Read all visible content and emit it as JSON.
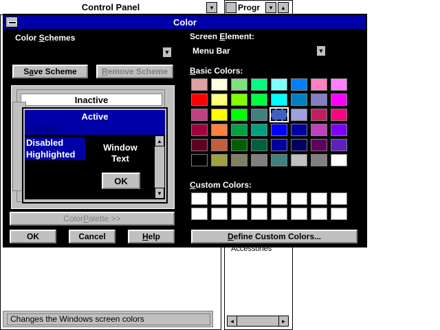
{
  "background": {
    "control_panel_title": "Control Panel",
    "program_manager_title": "Progr",
    "program_manager_item": "Accessories",
    "status_text": "Changes the Windows screen colors"
  },
  "dialog": {
    "title": "Color",
    "color_schemes_label_pre": "Color ",
    "color_schemes_label_u": "S",
    "color_schemes_label_post": "chemes",
    "color_scheme_value": "",
    "save_scheme_label_pre": "S",
    "save_scheme_label_u": "a",
    "save_scheme_label_post": "ve Scheme",
    "remove_scheme_label_pre": "",
    "remove_scheme_label_u": "R",
    "remove_scheme_label_post": "emove Scheme",
    "screen_element_label_pre": "Screen ",
    "screen_element_label_u": "E",
    "screen_element_label_post": "lement:",
    "screen_element_value": "Menu Bar",
    "basic_colors_label_u": "B",
    "basic_colors_label_post": "asic Colors:",
    "custom_colors_label_u": "C",
    "custom_colors_label_post": "ustom Colors:",
    "color_palette_label_pre": "Color ",
    "color_palette_label_u": "P",
    "color_palette_label_post": "alette >>",
    "ok_label": "OK",
    "cancel_label": "Cancel",
    "help_label_u": "H",
    "help_label_post": "elp",
    "define_custom_label_u": "D",
    "define_custom_label_post": "efine Custom Colors..."
  },
  "preview": {
    "inactive_title": "Inactive",
    "active_title": "Active",
    "menu_bar_text": "File  Edit",
    "disabled_text": "Disabled",
    "highlighted_text": "Highlighted",
    "window_text_line1": "Window",
    "window_text_line2": "Text",
    "ok_label": "OK"
  },
  "colors": {
    "basic": [
      [
        "#e0a0a0",
        "#ffffe0",
        "#80e080",
        "#00ff80",
        "#80ffff",
        "#0080ff",
        "#ff80c0",
        "#ff80ff"
      ],
      [
        "#ff0000",
        "#ffff80",
        "#80ff00",
        "#00ff40",
        "#00ffff",
        "#0080c0",
        "#8080c0",
        "#ff00ff"
      ],
      [
        "#c04080",
        "#ffff00",
        "#00ff00",
        "#408080",
        "#4060c0",
        "#a0a0e0",
        "#c02060",
        "#ff0080"
      ],
      [
        "#a00040",
        "#ff8040",
        "#00a040",
        "#00a080",
        "#0000ff",
        "#0000a0",
        "#c040c0",
        "#8000ff"
      ],
      [
        "#600020",
        "#c06040",
        "#006000",
        "#006040",
        "#0000a0",
        "#000060",
        "#600060",
        "#6020c0"
      ],
      [
        "#000000",
        "#a0a040",
        "#808060",
        "#808080",
        "#408080",
        "#c0c0c0",
        "#808080",
        "#ffffff"
      ]
    ],
    "selected_basic": [
      2,
      4
    ],
    "custom": [
      [
        "#ffffff",
        "#ffffff",
        "#ffffff",
        "#ffffff",
        "#ffffff",
        "#ffffff",
        "#ffffff",
        "#ffffff"
      ],
      [
        "#ffffff",
        "#ffffff",
        "#ffffff",
        "#ffffff",
        "#ffffff",
        "#ffffff",
        "#ffffff",
        "#ffffff"
      ]
    ]
  }
}
